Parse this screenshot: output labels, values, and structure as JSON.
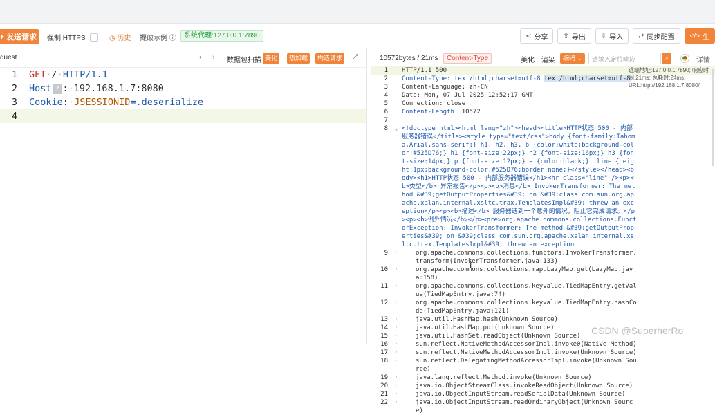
{
  "toolbar": {
    "send": "发送请求",
    "https": "强制 HTTPS",
    "history": "历史",
    "demo": "提破示例",
    "proxy": "系统代理:127.0.0.1:7890",
    "share": "分享",
    "export": "导出",
    "import": "导入",
    "sync": "同步配置",
    "generate": "生"
  },
  "request_panel": {
    "title": "quest",
    "scan": "数据包扫描",
    "beautify": "美化",
    "hotload": "热加载",
    "construct": "构造请求",
    "lines": [
      "1",
      "2",
      "3",
      "4"
    ],
    "method": "GET",
    "path": "/",
    "proto": "HTTP/1.1",
    "host_key": "Host",
    "host_val": "192.168.1.7:8080",
    "cookie_key": "Cookie",
    "cookie_name": "JSESSIONID",
    "cookie_val": "=.deserialize"
  },
  "response_panel": {
    "size": "10572bytes / 21ms",
    "content_type": "Content-Type",
    "beautify": "美化",
    "render": "渲染",
    "encoding": "编码",
    "search_placeholder": "请输入定位响应",
    "detail": "详情",
    "info": "远端地址:127.0.0.1:7890; 响应时间:21ms; 总耗时:24ms; URL:http://192.168.1.7:8080/",
    "status_line": "HTTP/1.1 500",
    "ct_line_key": "Content-Type:",
    "ct_line_val": "text/html;charset=utf-8",
    "ct_badge": "text/html;charset=utf-8",
    "lang_line": "Content-Language: zh-CN",
    "date_line": "Date: Mon, 07 Jul 2025 12:52:17 GMT",
    "conn_line": "Connection: close",
    "cl_key": "Content-Length:",
    "cl_val": "10572",
    "html_line": "<!doctype html><html lang=\"zh\"><head><title>HTTP状态 500 - 内部服务器错误</title><style type=\"text/css\">body {font-family:Tahoma,Arial,sans-serif;} h1, h2, h3, b {color:white;background-color:#525D76;} h1 {font-size:22px;} h2 {font-size:16px;} h3 {font-size:14px;} p {font-size:12px;} a {color:black;} .line {height:1px;background-color:#525D76;border:none;}</style></head><body><h1>HTTP状态 500 - 内部服务器错误</h1><hr class=\"line\" /><p><b>类型</b> 异常报告</p><p><b>消息</b> InvokerTransformer: The method &#39;getOutputProperties&#39; on &#39;class com.sun.org.apache.xalan.internal.xsltc.trax.TemplatesImpl&#39; threw an exception</p><p><b>描述</b> 服务器遇到一个意外的情况，阻止它完成请求。</p><p><b>例外情况</b></p><pre>org.apache.commons.collections.FunctorException: InvokerTransformer: The method &#39;getOutputProperties&#39; on &#39;class com.sun.org.apache.xalan.internal.xsltc.trax.TemplatesImpl&#39; threw an exception",
    "trace": [
      {
        "n": "9",
        "t": "org.apache.commons.collections.functors.InvokerTransformer.transform(InvokerTransformer.java:133)"
      },
      {
        "n": "10",
        "t": "org.apache.commons.collections.map.LazyMap.get(LazyMap.java:158)"
      },
      {
        "n": "11",
        "t": "org.apache.commons.collections.keyvalue.TiedMapEntry.getValue(TiedMapEntry.java:74)"
      },
      {
        "n": "12",
        "t": "org.apache.commons.collections.keyvalue.TiedMapEntry.hashCode(TiedMapEntry.java:121)"
      },
      {
        "n": "13",
        "t": "java.util.HashMap.hash(Unknown Source)"
      },
      {
        "n": "14",
        "t": "java.util.HashMap.put(Unknown Source)"
      },
      {
        "n": "15",
        "t": "java.util.HashSet.readObject(Unknown Source)"
      },
      {
        "n": "16",
        "t": "sun.reflect.NativeMethodAccessorImpl.invoke0(Native Method)"
      },
      {
        "n": "17",
        "t": "sun.reflect.NativeMethodAccessorImpl.invoke(Unknown Source)"
      },
      {
        "n": "18",
        "t": "sun.reflect.DelegatingMethodAccessorImpl.invoke(Unknown Source)"
      },
      {
        "n": "19",
        "t": "java.lang.reflect.Method.invoke(Unknown Source)"
      },
      {
        "n": "20",
        "t": "java.io.ObjectStreamClass.invokeReadObject(Unknown Source)"
      },
      {
        "n": "21",
        "t": "java.io.ObjectInputStream.readSerialData(Unknown Source)"
      },
      {
        "n": "22",
        "t": "java.io.ObjectInputStream.readOrdinaryObject(Unknown Source)"
      }
    ]
  },
  "watermark": "CSDN @SuperherRo"
}
